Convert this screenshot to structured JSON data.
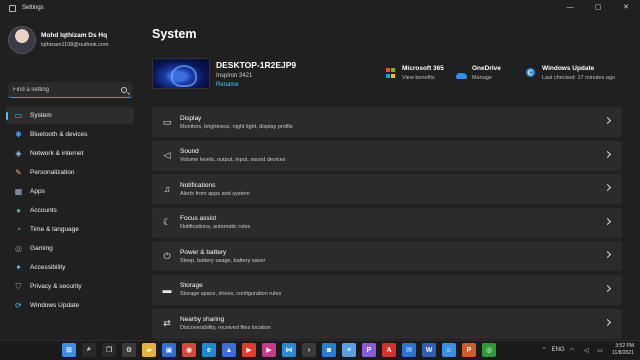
{
  "window": {
    "title": "Settings",
    "min": "—",
    "max": "▢",
    "close": "✕"
  },
  "profile": {
    "name": "Mohd Iqthizam Ds Hq",
    "email": "iqthizam1108@outlook.com"
  },
  "search": {
    "placeholder": "Find a setting"
  },
  "nav": [
    {
      "label": "System",
      "icon": "system-icon",
      "glyph": "▭",
      "color": "#4cc2ff",
      "active": true
    },
    {
      "label": "Bluetooth & devices",
      "icon": "bluetooth-icon",
      "glyph": "✱",
      "color": "#4c9fff"
    },
    {
      "label": "Network & internet",
      "icon": "network-icon",
      "glyph": "◈",
      "color": "#8ac7ff"
    },
    {
      "label": "Personalization",
      "icon": "brush-icon",
      "glyph": "✎",
      "color": "#f2a15b"
    },
    {
      "label": "Apps",
      "icon": "apps-icon",
      "glyph": "▦",
      "color": "#9bb5cc"
    },
    {
      "label": "Accounts",
      "icon": "accounts-icon",
      "glyph": "●",
      "color": "#3fb68b"
    },
    {
      "label": "Time & language",
      "icon": "clock-globe-icon",
      "glyph": "◔",
      "color": "#4cc2ff"
    },
    {
      "label": "Gaming",
      "icon": "gaming-icon",
      "glyph": "◎",
      "color": "#9a9a9a"
    },
    {
      "label": "Accessibility",
      "icon": "accessibility-icon",
      "glyph": "✦",
      "color": "#6fb7ff"
    },
    {
      "label": "Privacy & security",
      "icon": "shield-icon",
      "glyph": "⛉",
      "color": "#9a9a9a"
    },
    {
      "label": "Windows Update",
      "icon": "update-icon",
      "glyph": "⟳",
      "color": "#4cc2ff"
    }
  ],
  "main": {
    "title": "System",
    "device": {
      "name": "DESKTOP-1R2EJP9",
      "model": "Inspiron 3421",
      "rename": "Rename"
    },
    "quick": [
      {
        "title": "Microsoft 365",
        "sub": "View benefits",
        "icon": "microsoft-365-icon"
      },
      {
        "title": "OneDrive",
        "sub": "Manage",
        "icon": "onedrive-icon"
      },
      {
        "title": "Windows Update",
        "sub": "Last checked: 17 minutes ago",
        "icon": "windows-update-icon"
      }
    ],
    "cards": [
      {
        "title": "Display",
        "sub": "Monitors, brightness, night light, display profile",
        "icon": "display-icon",
        "glyph": "▭"
      },
      {
        "title": "Sound",
        "sub": "Volume levels, output, input, sound devices",
        "icon": "sound-icon",
        "glyph": "◁"
      },
      {
        "title": "Notifications",
        "sub": "Alerts from apps and system",
        "icon": "bell-icon",
        "glyph": "♫"
      },
      {
        "title": "Focus assist",
        "sub": "Notifications, automatic rules",
        "icon": "moon-icon",
        "glyph": "☾"
      },
      {
        "title": "Power & battery",
        "sub": "Sleep, battery usage, battery saver",
        "icon": "power-icon",
        "glyph": "⏻"
      },
      {
        "title": "Storage",
        "sub": "Storage space, drives, configuration rules",
        "icon": "storage-icon",
        "glyph": "▬"
      },
      {
        "title": "Nearby sharing",
        "sub": "Discoverability, received files location",
        "icon": "share-icon",
        "glyph": "⇄"
      }
    ]
  },
  "taskbar": {
    "apps": [
      {
        "icon": "windows-start-icon",
        "color": "#3a8ee6",
        "glyph": "⊞"
      },
      {
        "icon": "search-taskbar-icon",
        "color": "#2a2a2a",
        "glyph": "⌕"
      },
      {
        "icon": "task-view-icon",
        "color": "#2a2a2a",
        "glyph": "❐"
      },
      {
        "icon": "settings-app-icon",
        "color": "#3a3a3a",
        "glyph": "⚙"
      },
      {
        "icon": "file-explorer-icon",
        "color": "#e8b339",
        "glyph": "▰"
      },
      {
        "icon": "store-icon",
        "color": "#2f6fd6",
        "glyph": "▣"
      },
      {
        "icon": "chrome-icon",
        "color": "#d44a3a",
        "glyph": "◉"
      },
      {
        "icon": "edge-icon",
        "color": "#1f8ad2",
        "glyph": "e"
      },
      {
        "icon": "photos-icon",
        "color": "#3b6ed8",
        "glyph": "▲"
      },
      {
        "icon": "youtube-icon",
        "color": "#e53a2c",
        "glyph": "▶"
      },
      {
        "icon": "media-player-icon",
        "color": "#c83a8a",
        "glyph": "▶"
      },
      {
        "icon": "vscode-icon",
        "color": "#2a8ad8",
        "glyph": "⋈"
      },
      {
        "icon": "terminal-icon",
        "color": "#3a3a3a",
        "glyph": "›"
      },
      {
        "icon": "camera-icon",
        "color": "#2a7ed0",
        "glyph": "◙"
      },
      {
        "icon": "notepad-icon",
        "color": "#5aa0e0",
        "glyph": "≡"
      },
      {
        "icon": "pycharm-icon",
        "color": "#8a5ad8",
        "glyph": "P"
      },
      {
        "icon": "acrobat-icon",
        "color": "#d9302c",
        "glyph": "A"
      },
      {
        "icon": "mail-icon",
        "color": "#2b74d6",
        "glyph": "✉"
      },
      {
        "icon": "word-icon",
        "color": "#2f5fb8",
        "glyph": "W"
      },
      {
        "icon": "feedback-icon",
        "color": "#3a90e0",
        "glyph": "☺"
      },
      {
        "icon": "powerpoint-icon",
        "color": "#d45a2a",
        "glyph": "P"
      },
      {
        "icon": "xbox-icon",
        "color": "#2e9a3a",
        "glyph": "◎"
      }
    ],
    "tray": {
      "lang": "ENG",
      "time": "3:52 PM",
      "date": "11/8/2021"
    }
  }
}
